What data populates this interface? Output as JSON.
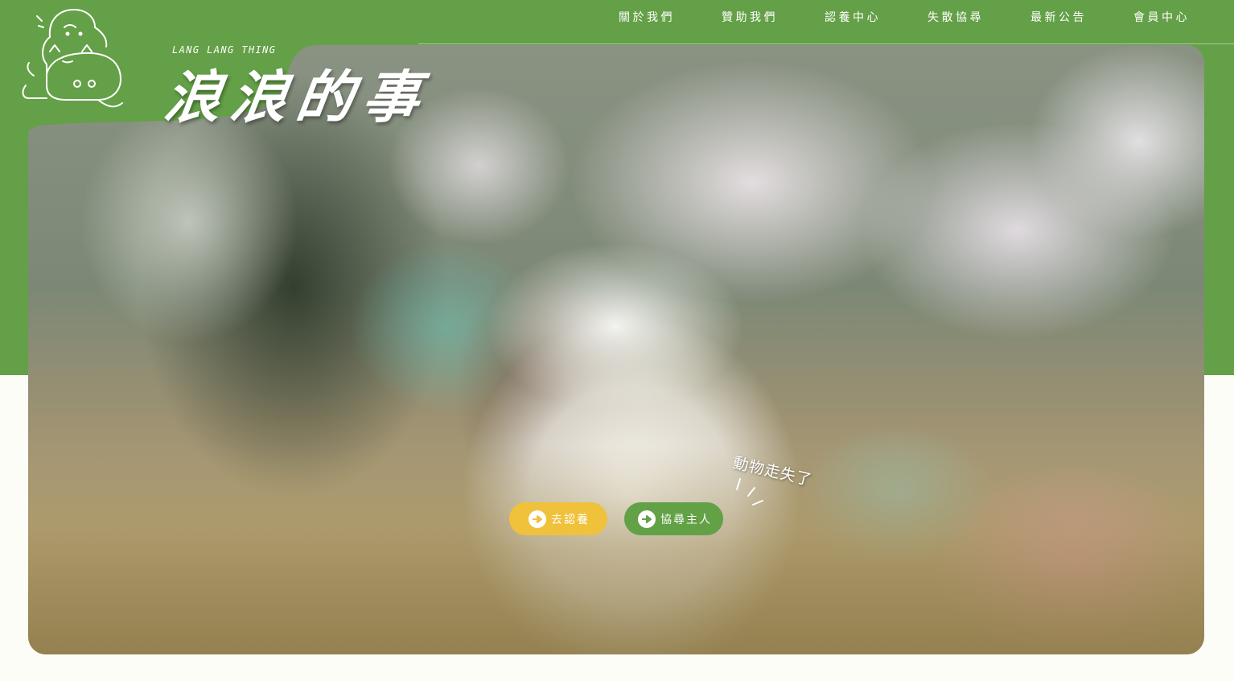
{
  "nav": {
    "items": [
      {
        "label": "關於我們"
      },
      {
        "label": "贊助我們"
      },
      {
        "label": "認養中心"
      },
      {
        "label": "失散協尋"
      },
      {
        "label": "最新公告"
      },
      {
        "label": "會員中心"
      }
    ]
  },
  "brand": {
    "name_en": "LANG LANG THING",
    "name_zh": "浪浪的事",
    "mascot_icon": "cat-dog-mascot-icon"
  },
  "hero": {
    "tag": "動物走失了",
    "buttons": {
      "adopt": {
        "label": "去認養",
        "icon": "arrow-right-icon"
      },
      "find_owner": {
        "label": "協尋主人",
        "icon": "arrow-right-icon"
      }
    }
  },
  "colors": {
    "brand_green": "#64a047",
    "accent_yellow": "#f0c13b",
    "page_background": "#fdfdf8"
  }
}
